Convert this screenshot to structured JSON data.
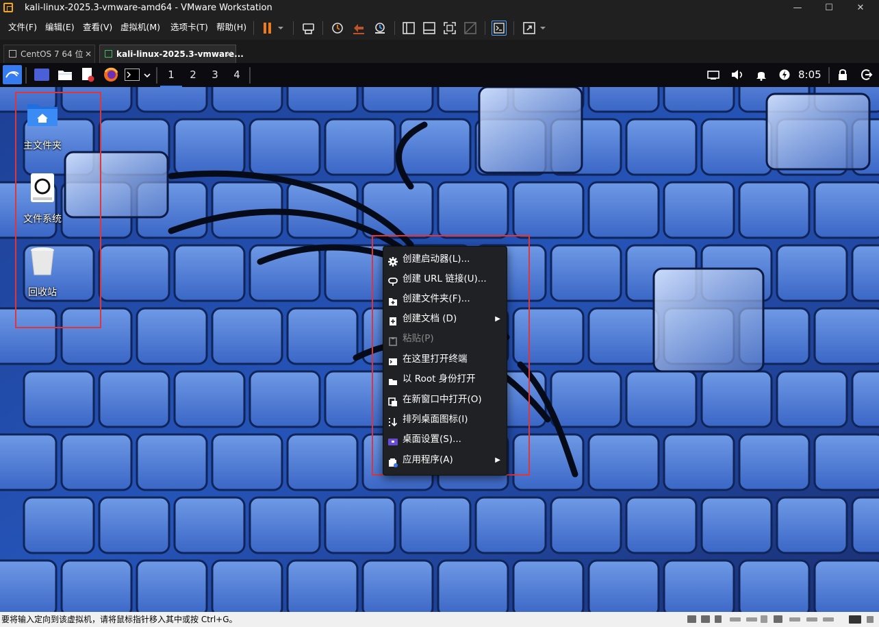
{
  "window": {
    "title": "kali-linux-2025.3-vmware-amd64 - VMware Workstation",
    "minimize": "—",
    "maximize": "☐",
    "close": "✕"
  },
  "menubar": {
    "items": [
      "文件(F)",
      "编辑(E)",
      "查看(V)",
      "虚拟机(M)",
      "选项卡(T)",
      "帮助(H)"
    ]
  },
  "toolbar": {
    "icons": [
      "pause-icon",
      "send-ctrl-alt-del-icon",
      "snapshot-icon",
      "revert-snapshot-icon",
      "snapshot-manager-icon",
      "sidebar-icon",
      "thumbnail-icon",
      "fullscreen-icon",
      "unity-icon",
      "console-icon",
      "stretch-icon"
    ]
  },
  "tabs": [
    {
      "label": "CentOS 7 64 位",
      "close": "✕",
      "active": false
    },
    {
      "label": "kali-linux-2025.3-vmware...",
      "close": "✕",
      "active": true
    }
  ],
  "panel": {
    "workspaces": [
      "1",
      "2",
      "3",
      "4"
    ],
    "clock": "8:05",
    "accent": "#367bf0"
  },
  "desktop": {
    "icons": [
      {
        "label": "主文件夹",
        "icon": "home-folder-icon"
      },
      {
        "label": "文件系统",
        "icon": "filesystem-drive-icon"
      },
      {
        "label": "回收站",
        "icon": "trash-icon"
      }
    ],
    "highlight_color": "#e0353a"
  },
  "context_menu": {
    "items": [
      {
        "label": "创建启动器(L)...",
        "icon": "gear-icon",
        "enabled": true,
        "submenu": false
      },
      {
        "label": "创建 URL 链接(U)...",
        "icon": "link-icon",
        "enabled": true,
        "submenu": false
      },
      {
        "label": "创建文件夹(F)...",
        "icon": "new-folder-icon",
        "enabled": true,
        "submenu": false
      },
      {
        "label": "创建文档 (D)",
        "icon": "new-document-icon",
        "enabled": true,
        "submenu": true
      },
      {
        "label": "粘贴(P)",
        "icon": "clipboard-icon",
        "enabled": false,
        "submenu": false
      },
      {
        "label": "在这里打开终端",
        "icon": "terminal-icon",
        "enabled": true,
        "submenu": false
      },
      {
        "label": "以 Root 身份打开",
        "icon": "folder-icon",
        "enabled": true,
        "submenu": false
      },
      {
        "label": "在新窗口中打开(O)",
        "icon": "new-window-icon",
        "enabled": true,
        "submenu": false
      },
      {
        "label": "排列桌面图标(I)",
        "icon": "sort-icon",
        "enabled": true,
        "submenu": false
      },
      {
        "label": "桌面设置(S)...",
        "icon": "desktop-settings-icon",
        "enabled": true,
        "submenu": false
      },
      {
        "label": "应用程序(A)",
        "icon": "applications-icon",
        "enabled": true,
        "submenu": true
      }
    ],
    "submenu_arrow": "▶"
  },
  "statusbar": {
    "text": "要将输入定向到该虚拟机，请将鼠标指针移入其中或按 Ctrl+G。"
  }
}
